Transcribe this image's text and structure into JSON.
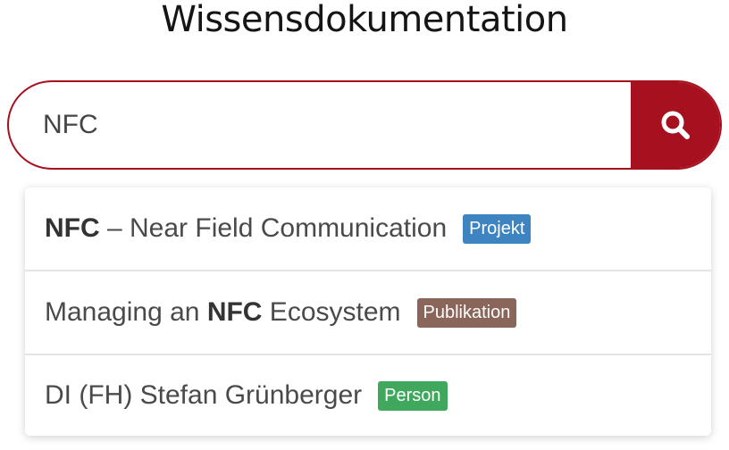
{
  "title": "Wissensdokumentation",
  "search": {
    "value": "NFC",
    "button_icon": "search-icon"
  },
  "suggestions": [
    {
      "before": "",
      "match": "NFC",
      "after": " – Near Field Communication",
      "badge": "Projekt",
      "badge_color": "#3e84c1"
    },
    {
      "before": "Managing an ",
      "match": "NFC",
      "after": " Ecosystem",
      "badge": "Publikation",
      "badge_color": "#8a6559"
    },
    {
      "before": "DI (FH) Stefan Grünberger",
      "match": "",
      "after": "",
      "badge": "Person",
      "badge_color": "#3fa85d"
    }
  ],
  "colors": {
    "accent": "#a6101f"
  }
}
